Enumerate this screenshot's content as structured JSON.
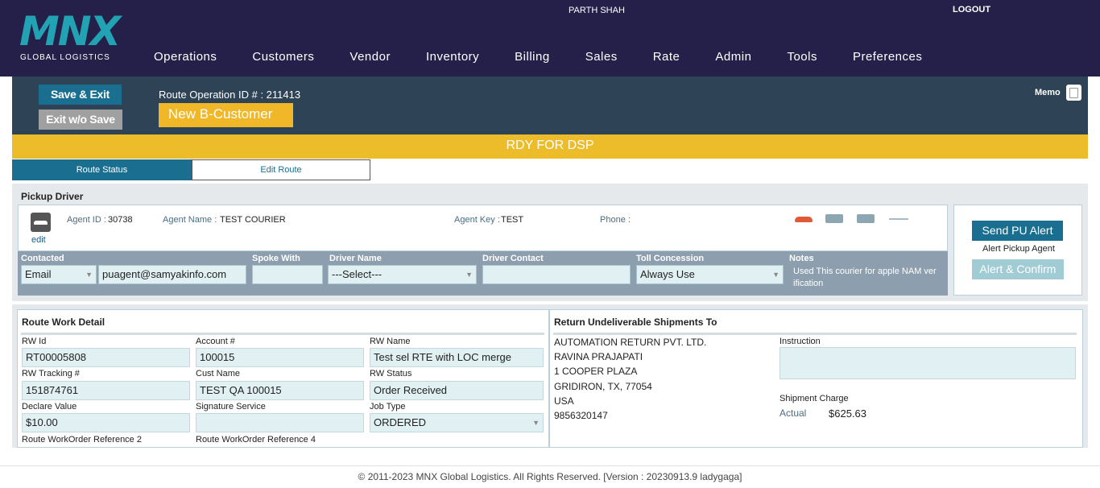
{
  "header": {
    "logo_mark": "MNX",
    "logo_sub": "GLOBAL LOGISTICS",
    "username": "PARTH SHAH",
    "logout": "LOGOUT",
    "nav": [
      "Operations",
      "Customers",
      "Vendor",
      "Inventory",
      "Billing",
      "Sales",
      "Rate",
      "Admin",
      "Tools",
      "Preferences"
    ]
  },
  "toolbar": {
    "save_exit": "Save & Exit",
    "exit_without_save": "Exit w/o Save",
    "route_operation_id": "Route Operation ID # : 211413",
    "customer_badge": "New B-Customer",
    "memo": "Memo"
  },
  "status": "RDY FOR DSP",
  "tabs": [
    {
      "label": "Route Status",
      "active": true
    },
    {
      "label": "Edit Route",
      "active": false
    }
  ],
  "pickup_driver": {
    "title": "Pickup Driver",
    "edit": "edit",
    "agent_id_label": "Agent ID :",
    "agent_id": "30738",
    "agent_name_label": "Agent Name :",
    "agent_name": "TEST COURIER",
    "agent_key_label": "Agent Key :",
    "agent_key": "TEST",
    "phone_label": "Phone :",
    "phone": "",
    "contact": {
      "contacted_label": "Contacted",
      "contacted_method": "Email",
      "contacted_value": "puagent@samyakinfo.com",
      "spoke_with_label": "Spoke With",
      "spoke_with": "",
      "driver_name_label": "Driver Name",
      "driver_name": "---Select---",
      "driver_contact_label": "Driver Contact",
      "driver_contact": "",
      "toll_concession_label": "Toll Concession",
      "toll_concession": "Always Use",
      "notes_label": "Notes",
      "notes": "Used This courier for apple NAM verification"
    },
    "alert": {
      "send_button": "Send PU Alert",
      "caption": "Alert Pickup Agent",
      "confirm_button": "Alert & Confirm"
    }
  },
  "route_work_detail": {
    "title": "Route Work Detail",
    "fields": {
      "rw_id_label": "RW Id",
      "rw_id": "RT00005808",
      "account_label": "Account #",
      "account": "100015",
      "rw_name_label": "RW Name",
      "rw_name": "Test sel RTE with LOC merge",
      "rw_tracking_label": "RW Tracking #",
      "rw_tracking": "151874761",
      "cust_name_label": "Cust Name",
      "cust_name": "TEST QA  100015",
      "rw_status_label": "RW Status",
      "rw_status": "Order Received",
      "declare_value_label": "Declare Value",
      "declare_value": "$10.00",
      "signature_service_label": "Signature Service",
      "signature_service": "",
      "job_type_label": "Job Type",
      "job_type": "ORDERED",
      "ref2_label": "Route WorkOrder Reference 2",
      "ref4_label": "Route WorkOrder Reference 4"
    }
  },
  "return_undeliverable": {
    "title": "Return Undeliverable Shipments To",
    "address": [
      "AUTOMATION RETURN PVT. LTD.",
      "RAVINA PRAJAPATI",
      "1 COOPER PLAZA",
      "GRIDIRON, TX, 77054",
      "USA",
      "9856320147"
    ],
    "instruction_label": "Instruction",
    "instruction": "",
    "shipment_charge_label": "Shipment Charge",
    "actual_label": "Actual",
    "actual_value": "$625.63"
  },
  "footer": "© 2011-2023 MNX Global Logistics. All Rights Reserved. [Version : 20230913.9 ladygaga]",
  "colors": {
    "topbar": "#25204a",
    "panel_dark": "#2e4456",
    "accent_blue": "#1a6f91",
    "status_yellow": "#ecbc2a",
    "badge_yellow": "#f0b828",
    "logo_teal": "#22a3b4"
  }
}
